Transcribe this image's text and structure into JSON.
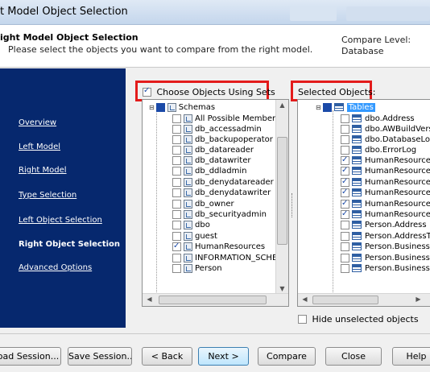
{
  "window": {
    "title": "t Model Object Selection"
  },
  "header": {
    "title": "ight Model Object Selection",
    "subtitle": "Please select the objects you want to compare from the right model.",
    "compare_level_label": "Compare Level:",
    "compare_level_value": "Database"
  },
  "sidebar": {
    "items": [
      {
        "label": "Overview",
        "active": false
      },
      {
        "label": "Left Model",
        "active": false
      },
      {
        "label": "Right Model",
        "active": false
      },
      {
        "label": "Type Selection",
        "active": false
      },
      {
        "label": "Left Object Selection",
        "active": false
      },
      {
        "label": "Right Object Selection",
        "active": true
      },
      {
        "label": "Advanced Options",
        "active": false
      }
    ]
  },
  "sets": {
    "checkbox_label": "Choose Objects Using Sets",
    "checked": true,
    "root_label": "Schemas",
    "items": [
      {
        "label": "All Possible Members",
        "checked": false
      },
      {
        "label": "db_accessadmin",
        "checked": false
      },
      {
        "label": "db_backupoperator",
        "checked": false
      },
      {
        "label": "db_datareader",
        "checked": false
      },
      {
        "label": "db_datawriter",
        "checked": false
      },
      {
        "label": "db_ddladmin",
        "checked": false
      },
      {
        "label": "db_denydatareader",
        "checked": false
      },
      {
        "label": "db_denydatawriter",
        "checked": false
      },
      {
        "label": "db_owner",
        "checked": false
      },
      {
        "label": "db_securityadmin",
        "checked": false
      },
      {
        "label": "dbo",
        "checked": false
      },
      {
        "label": "guest",
        "checked": false
      },
      {
        "label": "HumanResources",
        "checked": true
      },
      {
        "label": "INFORMATION_SCHE",
        "checked": false
      },
      {
        "label": "Person",
        "checked": false
      }
    ]
  },
  "selected": {
    "label": "Selected Objects:",
    "root_label": "Tables",
    "items": [
      {
        "label": "dbo.Address",
        "checked": false
      },
      {
        "label": "dbo.AWBuildVers",
        "checked": false
      },
      {
        "label": "dbo.DatabaseLog",
        "checked": false
      },
      {
        "label": "dbo.ErrorLog",
        "checked": false
      },
      {
        "label": "HumanResource",
        "checked": true
      },
      {
        "label": "HumanResource",
        "checked": true
      },
      {
        "label": "HumanResource",
        "checked": true
      },
      {
        "label": "HumanResource",
        "checked": true
      },
      {
        "label": "HumanResource",
        "checked": true
      },
      {
        "label": "HumanResource",
        "checked": true
      },
      {
        "label": "Person.Address",
        "checked": false
      },
      {
        "label": "Person.AddressT",
        "checked": false
      },
      {
        "label": "Person.BusinessI",
        "checked": false
      },
      {
        "label": "Person.BusinessI",
        "checked": false
      },
      {
        "label": "Person.BusinessI",
        "checked": false
      }
    ],
    "hide_unselected_label": "Hide unselected objects",
    "hide_unselected_checked": false
  },
  "buttons": {
    "load_session": "oad Session...",
    "save_session": "Save Session...",
    "back": "< Back",
    "next": "Next >",
    "compare": "Compare",
    "close": "Close",
    "help": "Help"
  },
  "colors": {
    "sidebar_bg": "#06286e",
    "highlight": "#e31b1b",
    "selection": "#3399ff"
  }
}
